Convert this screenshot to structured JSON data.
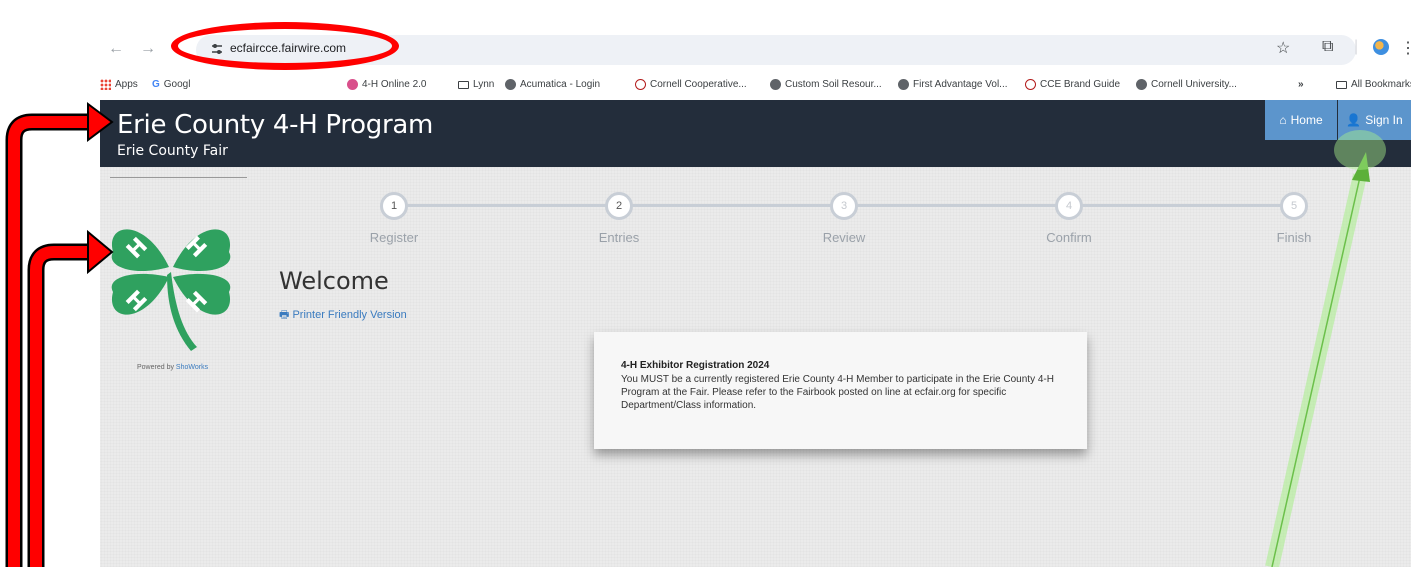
{
  "browser": {
    "url": "ecfaircce.fairwire.com",
    "bookmarks": [
      "Apps",
      "Googl",
      "4-H Online 2.0",
      "Lynn",
      "Acumatica - Login",
      "Cornell Cooperative...",
      "Custom Soil Resour...",
      "First Advantage Vol...",
      "CCE Brand Guide",
      "Cornell University...",
      "All Bookmarks"
    ],
    "overflow": "»"
  },
  "header": {
    "title": "Erie County 4-H Program",
    "subtitle": "Erie County Fair",
    "home_label": "Home",
    "signin_label": "Sign In"
  },
  "steps": [
    {
      "number": "1",
      "label": "Register"
    },
    {
      "number": "2",
      "label": "Entries"
    },
    {
      "number": "3",
      "label": "Review"
    },
    {
      "number": "4",
      "label": "Confirm"
    },
    {
      "number": "5",
      "label": "Finish"
    }
  ],
  "sidebar": {
    "powered_prefix": "Powered by",
    "powered_link": "ShoWorks"
  },
  "main": {
    "heading": "Welcome",
    "printer_link": "Printer Friendly Version",
    "notice_title": "4-H Exhibitor Registration 2024",
    "notice_body": " You MUST be a currently registered Erie County 4-H Member to participate in the Erie County 4-H Program at the Fair.  Please refer to the Fairbook posted on line at ecfair.org for specific Department/Class information."
  },
  "colors": {
    "header_bg": "#232d3b",
    "button_bg": "#5c95cc",
    "clover_green": "#2fa15f",
    "annotation_red": "#ff0000",
    "annotation_green": "#7ed957"
  }
}
